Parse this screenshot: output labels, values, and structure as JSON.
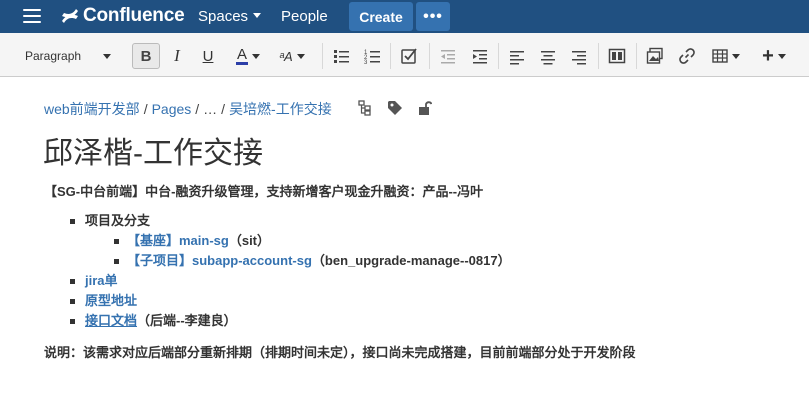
{
  "nav": {
    "logo_text": "Confluence",
    "spaces_label": "Spaces",
    "people_label": "People",
    "create_label": "Create",
    "more_label": "•••"
  },
  "toolbar": {
    "paragraph_label": "Paragraph",
    "bold_label": "B",
    "italic_label": "I",
    "underline_label": "U",
    "color_label": "A",
    "clear_label": "ᵃA",
    "plus_label": "+"
  },
  "breadcrumb": {
    "items": [
      "web前端开发部",
      "Pages",
      "…",
      "吴培燃-工作交接"
    ],
    "separator": "/"
  },
  "page": {
    "title": "邱泽楷-工作交接",
    "summary": "【SG-中台前端】中台-融资升级管理，支持新增客户现金升融资：产品--冯叶",
    "list": {
      "project_label": "项目及分支",
      "base_link": "【基座】main-sg",
      "base_suffix": "（sit）",
      "sub_link": "【子项目】subapp-account-sg",
      "sub_suffix": "（ben_upgrade-manage--0817）",
      "jira_link": "jira单",
      "prototype_link": "原型地址",
      "api_link": "接口文档",
      "api_suffix": "（后端--李建良）"
    },
    "note": "说明：该需求对应后端部分重新排期（排期时间未定），接口尚未完成搭建，目前前端部分处于开发阶段"
  },
  "colors": {
    "nav_bg": "#205081",
    "button_bg": "#3572b0",
    "link": "#3572b0",
    "text": "#333333"
  }
}
